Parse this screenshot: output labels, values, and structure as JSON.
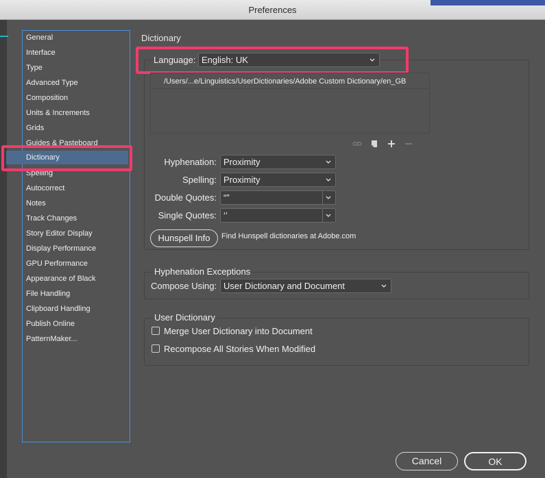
{
  "window": {
    "title": "Preferences"
  },
  "sidebar": {
    "items": [
      {
        "label": "General"
      },
      {
        "label": "Interface"
      },
      {
        "label": "Type"
      },
      {
        "label": "Advanced Type"
      },
      {
        "label": "Composition"
      },
      {
        "label": "Units & Increments"
      },
      {
        "label": "Grids"
      },
      {
        "label": "Guides & Pasteboard"
      },
      {
        "label": "Dictionary",
        "selected": true
      },
      {
        "label": "Spelling"
      },
      {
        "label": "Autocorrect"
      },
      {
        "label": "Notes"
      },
      {
        "label": "Track Changes"
      },
      {
        "label": "Story Editor Display"
      },
      {
        "label": "Display Performance"
      },
      {
        "label": "GPU Performance"
      },
      {
        "label": "Appearance of Black"
      },
      {
        "label": "File Handling"
      },
      {
        "label": "Clipboard Handling"
      },
      {
        "label": "Publish Online"
      },
      {
        "label": "PatternMaker..."
      }
    ]
  },
  "panel": {
    "title": "Dictionary",
    "language": {
      "label": "Language:",
      "value": "English: UK"
    },
    "dictionary_list": [
      "/Users/...e/Linguistics/UserDictionaries/Adobe Custom Dictionary/en_GB"
    ],
    "list_icons": [
      "link-icon",
      "new-dictionary-icon",
      "add-icon",
      "remove-icon"
    ],
    "hyphenation": {
      "label": "Hyphenation:",
      "value": "Proximity"
    },
    "spelling": {
      "label": "Spelling:",
      "value": "Proximity"
    },
    "double_quotes": {
      "label": "Double Quotes:",
      "value": "“”"
    },
    "single_quotes": {
      "label": "Single Quotes:",
      "value": "‘’"
    },
    "hunspell": {
      "button": "Hunspell Info",
      "text": "Find Hunspell dictionaries at Adobe.com"
    },
    "hyphenation_exceptions": {
      "title": "Hyphenation Exceptions",
      "compose_label": "Compose Using:",
      "compose_value": "User Dictionary and Document"
    },
    "user_dictionary": {
      "title": "User Dictionary",
      "merge": {
        "label": "Merge User Dictionary into Document",
        "checked": false
      },
      "recompose": {
        "label": "Recompose All Stories When Modified",
        "checked": false
      }
    }
  },
  "footer": {
    "cancel": "Cancel",
    "ok": "OK"
  },
  "colors": {
    "highlight": "#f03c6d",
    "selection": "#4c6b8e",
    "sidebar_border": "#4a90d9"
  }
}
